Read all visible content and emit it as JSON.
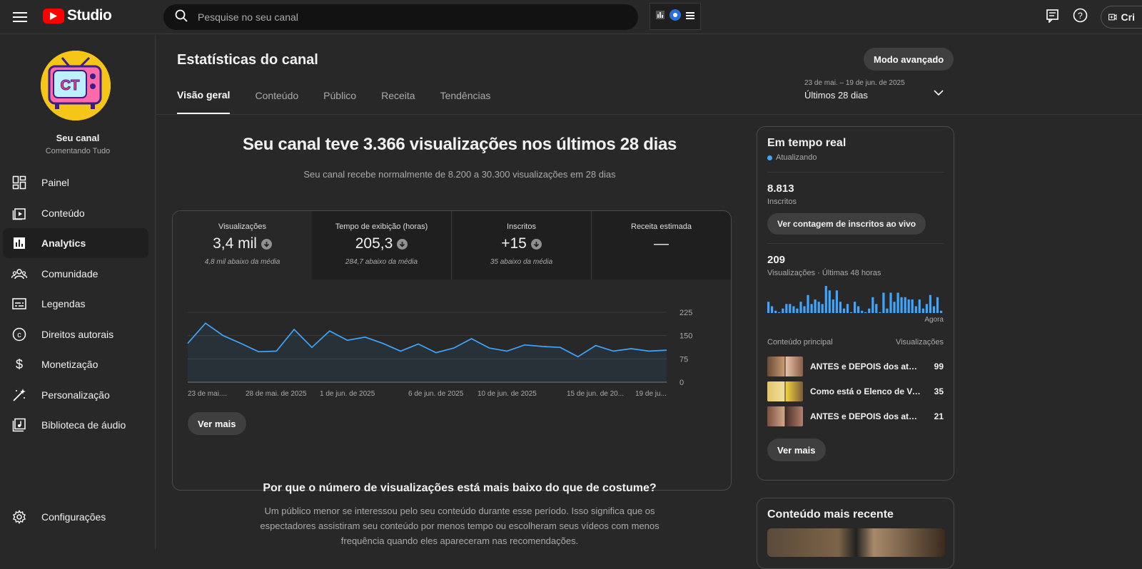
{
  "app": {
    "name": "Studio"
  },
  "search": {
    "placeholder": "Pesquise no seu canal"
  },
  "header": {
    "create_label": "Cri"
  },
  "channel": {
    "name": "Seu canal",
    "subtitle": "Comentando Tudo",
    "avatar_text": "CT"
  },
  "sidebar": {
    "items": [
      {
        "label": "Painel",
        "icon": "dashboard-icon"
      },
      {
        "label": "Conteúdo",
        "icon": "content-icon"
      },
      {
        "label": "Analytics",
        "icon": "analytics-icon",
        "active": true
      },
      {
        "label": "Comunidade",
        "icon": "community-icon"
      },
      {
        "label": "Legendas",
        "icon": "subtitles-icon"
      },
      {
        "label": "Direitos autorais",
        "icon": "copyright-icon"
      },
      {
        "label": "Monetização",
        "icon": "dollar-icon"
      },
      {
        "label": "Personalização",
        "icon": "magic-wand-icon"
      },
      {
        "label": "Biblioteca de áudio",
        "icon": "audio-library-icon"
      }
    ],
    "settings_label": "Configurações"
  },
  "page": {
    "title": "Estatísticas do canal",
    "advanced_label": "Modo avançado",
    "tabs": [
      "Visão geral",
      "Conteúdo",
      "Público",
      "Receita",
      "Tendências"
    ],
    "date_range": "23 de mai. – 19 de jun. de 2025",
    "date_label": "Últimos 28 dias"
  },
  "overview": {
    "headline": "Seu canal teve 3.366 visualizações nos últimos 28 dias",
    "subline": "Seu canal recebe normalmente de 8.200 a 30.300 visualizações em 28 dias",
    "metrics": [
      {
        "label": "Visualizações",
        "value": "3,4 mil",
        "note": "4,8 mil abaixo da média",
        "trend": "down"
      },
      {
        "label": "Tempo de exibição (horas)",
        "value": "205,3",
        "note": "284,7 abaixo da média",
        "trend": "down"
      },
      {
        "label": "Inscritos",
        "value": "+15",
        "note": "35 abaixo da média",
        "trend": "down"
      },
      {
        "label": "Receita estimada",
        "value": "—",
        "note": "",
        "trend": "none"
      }
    ],
    "more_label": "Ver mais",
    "why_title": "Por que o número de visualizações está mais baixo do que de costume?",
    "why_text": "Um público menor se interessou pelo seu conteúdo durante esse período. Isso significa que os espectadores assistiram seu conteúdo por menos tempo ou escolheram seus vídeos com menos frequência quando eles apareceram nas recomendações."
  },
  "chart_data": [
    {
      "type": "line",
      "x_tick_labels": [
        "23 de mai....",
        "28 de mai. de 2025",
        "1 de jun. de 2025",
        "6 de jun. de 2025",
        "10 de jun. de 2025",
        "15 de jun. de 20...",
        "19 de ju..."
      ],
      "y_ticks": [
        0,
        75,
        150,
        225
      ],
      "ylim": [
        0,
        225
      ],
      "values": [
        125,
        190,
        150,
        125,
        98,
        100,
        170,
        112,
        165,
        135,
        145,
        125,
        100,
        123,
        95,
        110,
        140,
        110,
        100,
        120,
        115,
        112,
        82,
        118,
        100,
        108,
        100,
        103
      ],
      "color": "#3ea6ff"
    },
    {
      "type": "bar",
      "series_label": "Visualizações · Últimas 48 horas",
      "x_end_label": "Agora",
      "values": [
        5,
        3,
        1,
        0,
        2,
        4,
        4,
        3,
        2,
        5,
        3,
        8,
        4,
        6,
        5,
        4,
        12,
        10,
        6,
        10,
        5,
        2,
        4,
        0,
        5,
        3,
        1,
        0,
        2,
        7,
        4,
        0,
        9,
        2,
        9,
        5,
        9,
        7,
        7,
        6,
        6,
        3,
        6,
        2,
        4,
        8,
        3,
        7,
        1
      ],
      "color": "#3ea6ff"
    }
  ],
  "realtime": {
    "title": "Em tempo real",
    "status": "Atualizando",
    "subscribers": "8.813",
    "subscribers_label": "Inscritos",
    "live_count_label": "Ver contagem de inscritos ao vivo",
    "views": "209",
    "views_label": "Visualizações · Últimas 48 horas",
    "now_label": "Agora",
    "top_content_label": "Conteúdo principal",
    "views_col_label": "Visualizações",
    "top_content": [
      {
        "title": "ANTES e DEPOIS dos atores…",
        "views": "99"
      },
      {
        "title": "Como está o Elenco de Vai …",
        "views": "35"
      },
      {
        "title": "ANTES e DEPOIS dos atores…",
        "views": "21"
      }
    ],
    "more_label": "Ver mais"
  },
  "recent": {
    "title": "Conteúdo mais recente"
  }
}
